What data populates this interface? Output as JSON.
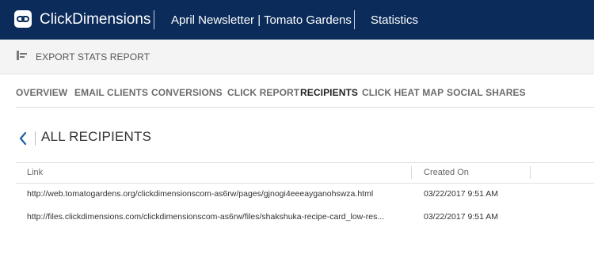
{
  "header": {
    "brand": "ClickDimensions",
    "breadcrumb": [
      "April Newsletter | Tomato Gardens",
      "Statistics"
    ]
  },
  "toolbar": {
    "export_label": "EXPORT STATS REPORT"
  },
  "tabs": [
    {
      "label": "OVERVIEW"
    },
    {
      "label": "EMAIL CLIENTS"
    },
    {
      "label": "CONVERSIONS"
    },
    {
      "label": "CLICK REPORT"
    },
    {
      "label": "RECIPIENTS"
    },
    {
      "label": "CLICK HEAT MAP"
    },
    {
      "label": "SOCIAL SHARES"
    }
  ],
  "active_tab": "RECIPIENTS",
  "section": {
    "title": "ALL RECIPIENTS"
  },
  "table": {
    "columns": [
      "Link",
      "Created On"
    ],
    "rows": [
      {
        "link": "http://web.tomatogardens.org/clickdimensionscom-as6rw/pages/gjnogi4eeeayganohswza.html",
        "created_on": "03/22/2017 9:51 AM"
      },
      {
        "link": "http://files.clickdimensions.com/clickdimensionscom-as6rw/files/shakshuka-recipe-card_low-res...",
        "created_on": "03/22/2017 9:51 AM"
      }
    ]
  },
  "colors": {
    "header_bg": "#0b2b5a",
    "accent": "#1f5fa8"
  },
  "icons": {
    "logo": "clickdimensions-logo-icon",
    "export": "export-icon",
    "back": "chevron-left-icon"
  }
}
